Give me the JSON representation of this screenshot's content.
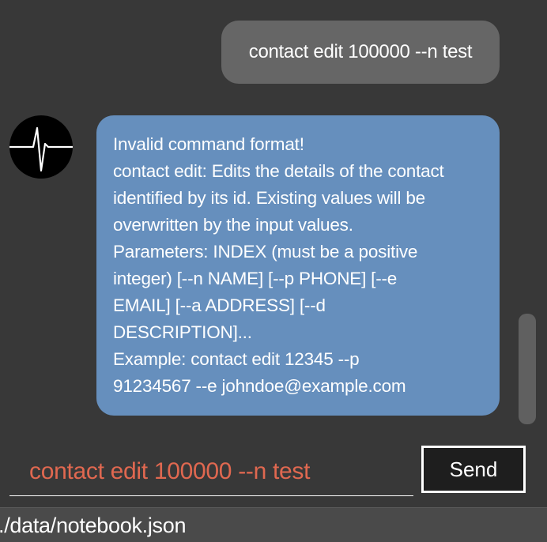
{
  "chat": {
    "user_message": "contact edit 100000 --n test",
    "bot_message_lines": [
      "Invalid command format!",
      "contact edit: Edits the details of the contact",
      "identified by its id. Existing values will be",
      "overwritten by the input values.",
      "Parameters: INDEX (must be a positive",
      "integer) [--n NAME] [--p PHONE] [--e",
      "EMAIL] [--a ADDRESS] [--d",
      "DESCRIPTION]...",
      "Example: contact edit 12345 --p",
      "91234567 --e johndoe@example.com"
    ],
    "avatar_icon": "heartbeat-icon"
  },
  "input": {
    "value": "contact edit 100000 --n test",
    "send_label": "Send"
  },
  "status_bar": {
    "path": "./data/notebook.json"
  },
  "colors": {
    "background": "#383838",
    "user_bubble": "#666666",
    "bot_bubble": "#668fbd",
    "input_text": "#e06850",
    "status_bar": "#4a4a4a"
  }
}
